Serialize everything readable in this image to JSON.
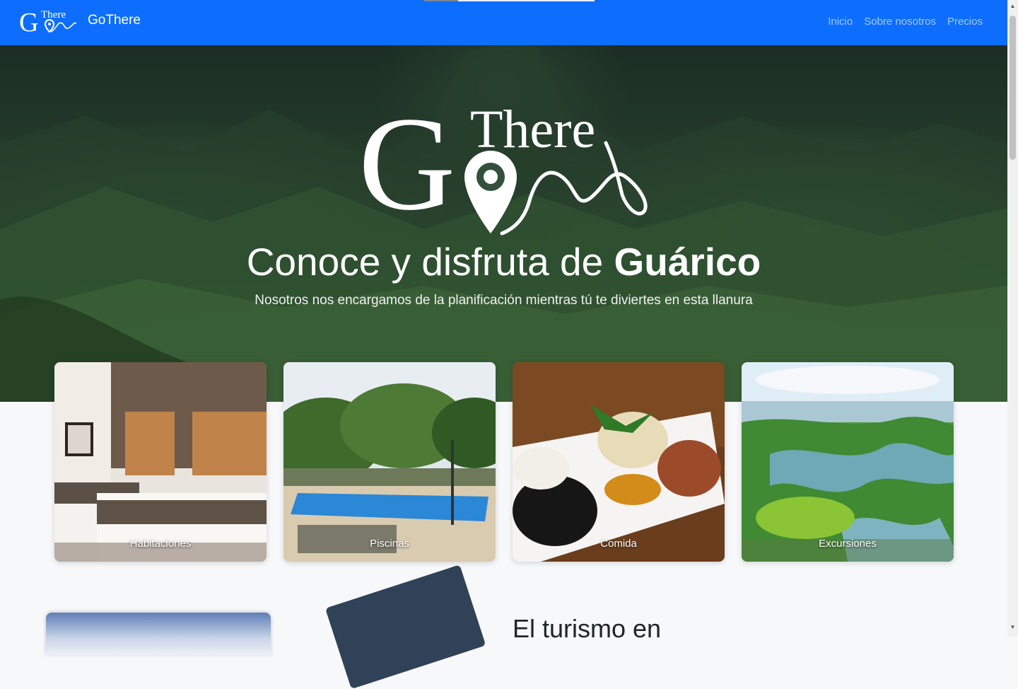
{
  "nav": {
    "brand": "GoThere",
    "logo_text_big": "G",
    "logo_text_small": "There",
    "links": [
      "Inicio",
      "Sobre nosotros",
      "Precios"
    ]
  },
  "hero": {
    "title_prefix": "Conoce y disfruta de ",
    "title_bold": "Guárico",
    "subtitle": "Nosotros nos encargamos de la planificación mientras tú te diviertes en esta llanura"
  },
  "cards": [
    {
      "label": "Habitaciones"
    },
    {
      "label": "Piscinas"
    },
    {
      "label": "Comida"
    },
    {
      "label": "Excursiones"
    }
  ],
  "section": {
    "title": "El turismo en"
  },
  "colors": {
    "navbar": "#0d6efd",
    "page_bg": "#f7f8fa"
  }
}
